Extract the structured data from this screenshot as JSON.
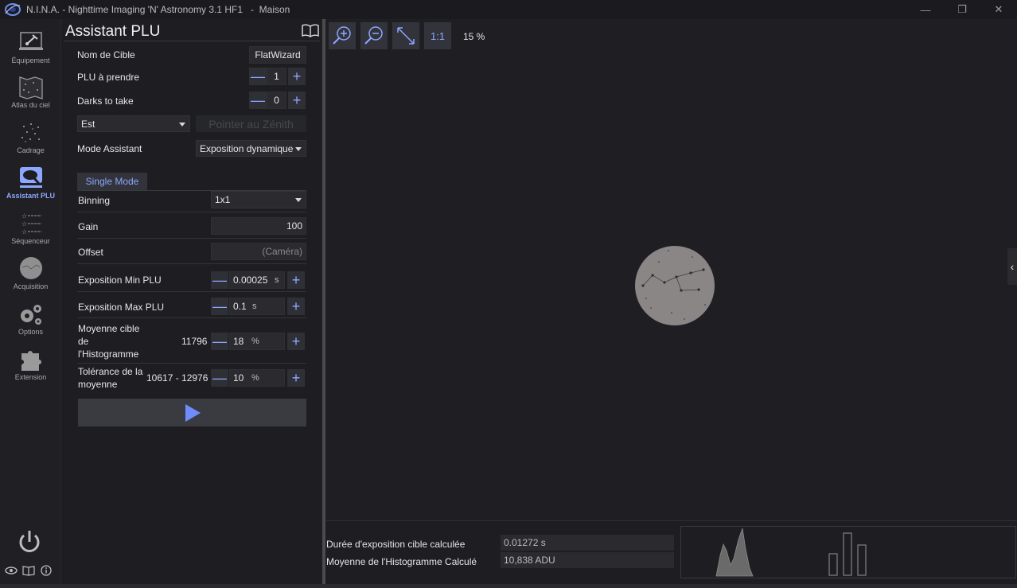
{
  "window": {
    "title": "N.I.N.A. - Nighttime Imaging 'N' Astronomy 3.1 HF1   -  Maison",
    "minimize": "—",
    "maximize": "❐",
    "close": "✕"
  },
  "sidebar": {
    "items": [
      {
        "label": "Équipement",
        "icon": "telescope-icon"
      },
      {
        "label": "Atlas du ciel",
        "icon": "sky-atlas-icon"
      },
      {
        "label": "Cadrage",
        "icon": "framing-icon"
      },
      {
        "label": "Assistant PLU",
        "icon": "flat-wizard-icon",
        "active": true
      },
      {
        "label": "Séquenceur",
        "icon": "sequencer-icon"
      },
      {
        "label": "Acquisition",
        "icon": "imaging-icon"
      },
      {
        "label": "Options",
        "icon": "gears-icon"
      },
      {
        "label": "Extension",
        "icon": "puzzle-icon"
      }
    ]
  },
  "panel": {
    "title": "Assistant PLU",
    "target_name_label": "Nom de Cible",
    "target_name_value": "FlatWizard",
    "flats_label": "PLU à prendre",
    "flats_value": "1",
    "darks_label": "Darks to take",
    "darks_value": "0",
    "direction_value": "Est",
    "zenith_button": "Pointer au Zénith",
    "mode_label": "Mode Assistant",
    "mode_value": "Exposition dynamique",
    "tab_label": "Single Mode",
    "binning_label": "Binning",
    "binning_value": "1x1",
    "gain_label": "Gain",
    "gain_value": "100",
    "offset_label": "Offset",
    "offset_placeholder": "(Caméra)",
    "min_exp_label": "Exposition Min PLU",
    "min_exp_value": "0.00025",
    "min_exp_unit": "s",
    "max_exp_label": "Exposition Max PLU",
    "max_exp_value": "0.1",
    "max_exp_unit": "s",
    "hist_mean_label_1": "Moyenne cible",
    "hist_mean_label_2": "de",
    "hist_mean_label_3": "l'Histogramme",
    "hist_mean_adu": "11796",
    "hist_mean_value": "18",
    "hist_mean_unit": "%",
    "tolerance_label_1": "Tolérance de la",
    "tolerance_label_2": "moyenne",
    "tolerance_range": "10617 - 12976",
    "tolerance_value": "10",
    "tolerance_unit": "%"
  },
  "image": {
    "zoom_level": "15 %",
    "one_to_one": "1:1"
  },
  "results": {
    "exposure_label": "Durée d'exposition cible calculée",
    "exposure_value": "0.01272 s",
    "hist_label": "Moyenne de l'Histogramme Calculé",
    "hist_value": "10,838 ADU"
  },
  "colors": {
    "accent": "#8ea6ff",
    "background": "#1e1e22",
    "control": "#2a2a2f"
  }
}
